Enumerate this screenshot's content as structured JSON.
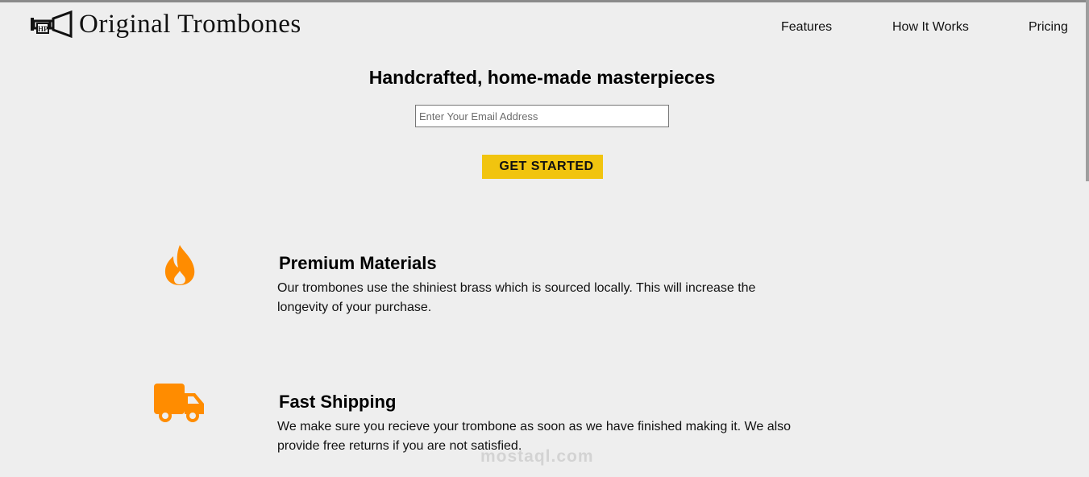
{
  "brand": {
    "name": "Original Trombones",
    "logo_icon": "trombone-logo-icon"
  },
  "nav": {
    "items": [
      {
        "label": "Features"
      },
      {
        "label": "How It Works"
      },
      {
        "label": "Pricing"
      }
    ]
  },
  "hero": {
    "title": "Handcrafted, home-made masterpieces",
    "email_placeholder": "Enter Your Email Address",
    "email_value": "",
    "cta_label": "GET STARTED"
  },
  "features": [
    {
      "icon": "fire-icon",
      "title": "Premium Materials",
      "text": "Our trombones use the shiniest brass which is sourced locally. This will increase the longevity of your purchase."
    },
    {
      "icon": "truck-icon",
      "title": "Fast Shipping",
      "text": "We make sure you recieve your trombone as soon as we have finished making it. We also provide free returns if you are not satisfied."
    }
  ],
  "watermark": {
    "text": "mostaql.com"
  },
  "colors": {
    "background": "#eeeeee",
    "accent": "#f1c40f",
    "icon": "#ff8c00"
  }
}
